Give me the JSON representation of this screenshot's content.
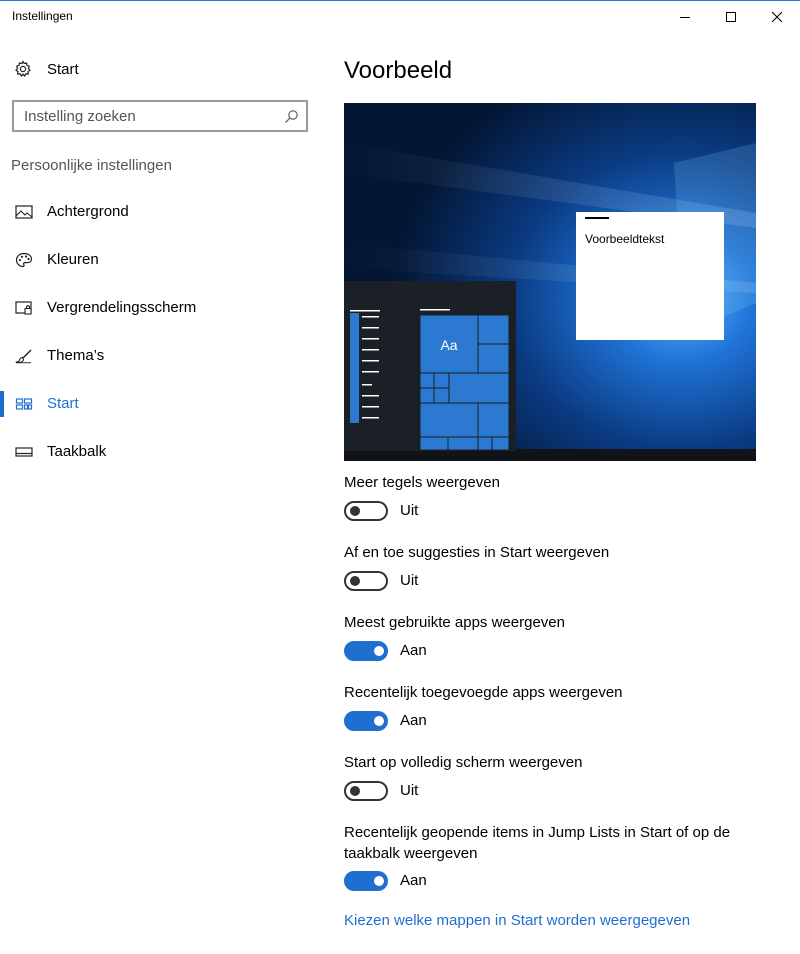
{
  "window": {
    "title": "Instellingen"
  },
  "sidebar": {
    "home_label": "Start",
    "search_placeholder": "Instelling zoeken",
    "group_title": "Persoonlijke instellingen",
    "items": [
      {
        "label": "Achtergrond",
        "icon": "picture-icon",
        "active": false
      },
      {
        "label": "Kleuren",
        "icon": "palette-icon",
        "active": false
      },
      {
        "label": "Vergrendelingsscherm",
        "icon": "lock-screen-icon",
        "active": false
      },
      {
        "label": "Thema’s",
        "icon": "brush-icon",
        "active": false
      },
      {
        "label": "Start",
        "icon": "start-tiles-icon",
        "active": true
      },
      {
        "label": "Taakbalk",
        "icon": "taskbar-icon",
        "active": false
      }
    ]
  },
  "main": {
    "heading": "Voorbeeld",
    "preview": {
      "sample_text": "Voorbeeldtekst",
      "tile_text": "Aa"
    },
    "settings": [
      {
        "label": "Meer tegels weergeven",
        "state": "Uit",
        "on": false
      },
      {
        "label": "Af en toe suggesties in Start weergeven",
        "state": "Uit",
        "on": false
      },
      {
        "label": "Meest gebruikte apps weergeven",
        "state": "Aan",
        "on": true
      },
      {
        "label": "Recentelijk toegevoegde apps weergeven",
        "state": "Aan",
        "on": true
      },
      {
        "label": "Start op volledig scherm weergeven",
        "state": "Uit",
        "on": false
      },
      {
        "label": "Recentelijk geopende items in Jump Lists in Start of op de taakbalk weergeven",
        "state": "Aan",
        "on": true
      }
    ],
    "link": "Kiezen welke mappen in Start worden weergegeven"
  },
  "colors": {
    "accent": "#1f6fd1",
    "preview_bg": "#0b2a5c",
    "start_menu": "#1b1f26"
  }
}
